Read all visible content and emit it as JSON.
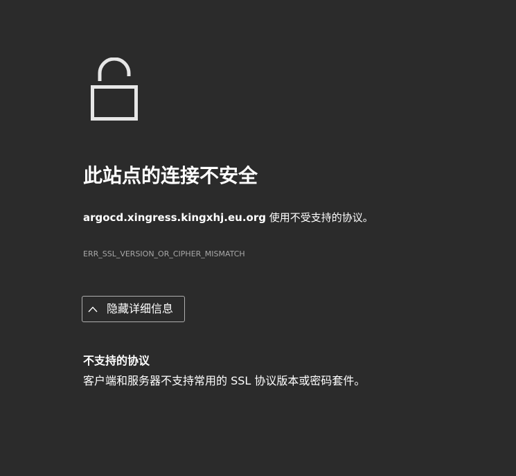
{
  "error_page": {
    "lock_icon": "open-padlock-icon",
    "title": "此站点的连接不安全",
    "message": {
      "host": "argocd.xingress.kingxhj.eu.org",
      "text": " 使用不受支持的协议。"
    },
    "error_code": "ERR_SSL_VERSION_OR_CIPHER_MISMATCH",
    "details_button": {
      "icon": "chevron-up-icon",
      "label": "隐藏详细信息"
    },
    "details": {
      "heading": "不支持的协议",
      "body": "客户端和服务器不支持常用的 SSL 协议版本或密码套件。"
    }
  },
  "colors": {
    "background": "#2b2b2b",
    "text": "#ffffff",
    "muted_text": "#a8a8a8",
    "button_border": "#b0b0b0",
    "icon_stroke": "#e6e6e6"
  }
}
